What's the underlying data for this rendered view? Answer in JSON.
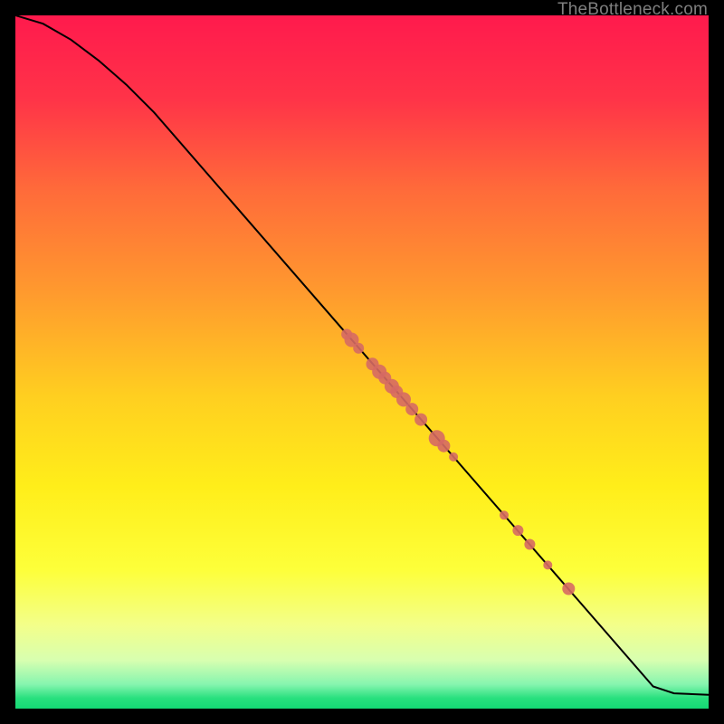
{
  "attribution": "TheBottleneck.com",
  "chart_data": {
    "type": "line",
    "title": "",
    "xlabel": "",
    "ylabel": "",
    "xlim": [
      0,
      100
    ],
    "ylim": [
      0,
      100
    ],
    "curve": [
      {
        "x": 0,
        "y": 100
      },
      {
        "x": 4,
        "y": 98.8
      },
      {
        "x": 8,
        "y": 96.5
      },
      {
        "x": 12,
        "y": 93.5
      },
      {
        "x": 16,
        "y": 90.0
      },
      {
        "x": 20,
        "y": 86.0
      },
      {
        "x": 92,
        "y": 3.2
      },
      {
        "x": 95,
        "y": 2.2
      },
      {
        "x": 100,
        "y": 2.0
      }
    ],
    "scatter_points": [
      {
        "x": 47.8,
        "y": 54.0,
        "r": 6
      },
      {
        "x": 48.5,
        "y": 53.2,
        "r": 8
      },
      {
        "x": 49.5,
        "y": 52.0,
        "r": 6
      },
      {
        "x": 51.5,
        "y": 49.7,
        "r": 7
      },
      {
        "x": 52.5,
        "y": 48.6,
        "r": 8
      },
      {
        "x": 53.3,
        "y": 47.7,
        "r": 7
      },
      {
        "x": 54.3,
        "y": 46.5,
        "r": 8
      },
      {
        "x": 55.0,
        "y": 45.7,
        "r": 7
      },
      {
        "x": 56.0,
        "y": 44.6,
        "r": 8
      },
      {
        "x": 57.2,
        "y": 43.2,
        "r": 7
      },
      {
        "x": 58.5,
        "y": 41.7,
        "r": 7
      },
      {
        "x": 60.8,
        "y": 39.0,
        "r": 9
      },
      {
        "x": 61.8,
        "y": 37.9,
        "r": 7
      },
      {
        "x": 63.2,
        "y": 36.3,
        "r": 5
      },
      {
        "x": 70.5,
        "y": 27.9,
        "r": 5
      },
      {
        "x": 72.5,
        "y": 25.7,
        "r": 6
      },
      {
        "x": 74.2,
        "y": 23.7,
        "r": 6
      },
      {
        "x": 76.8,
        "y": 20.7,
        "r": 5
      },
      {
        "x": 79.8,
        "y": 17.3,
        "r": 7
      }
    ],
    "gradient_stops": [
      {
        "offset": 0.0,
        "color": "#ff1a4d"
      },
      {
        "offset": 0.12,
        "color": "#ff3348"
      },
      {
        "offset": 0.25,
        "color": "#ff6a3a"
      },
      {
        "offset": 0.4,
        "color": "#ff9a2e"
      },
      {
        "offset": 0.55,
        "color": "#ffcf20"
      },
      {
        "offset": 0.68,
        "color": "#ffee1a"
      },
      {
        "offset": 0.8,
        "color": "#fdff3a"
      },
      {
        "offset": 0.88,
        "color": "#f3ff8a"
      },
      {
        "offset": 0.93,
        "color": "#d8ffb0"
      },
      {
        "offset": 0.965,
        "color": "#86f5af"
      },
      {
        "offset": 0.985,
        "color": "#28e07e"
      },
      {
        "offset": 1.0,
        "color": "#14d874"
      }
    ],
    "marker_color": "#d66a63",
    "line_color": "#000000"
  }
}
